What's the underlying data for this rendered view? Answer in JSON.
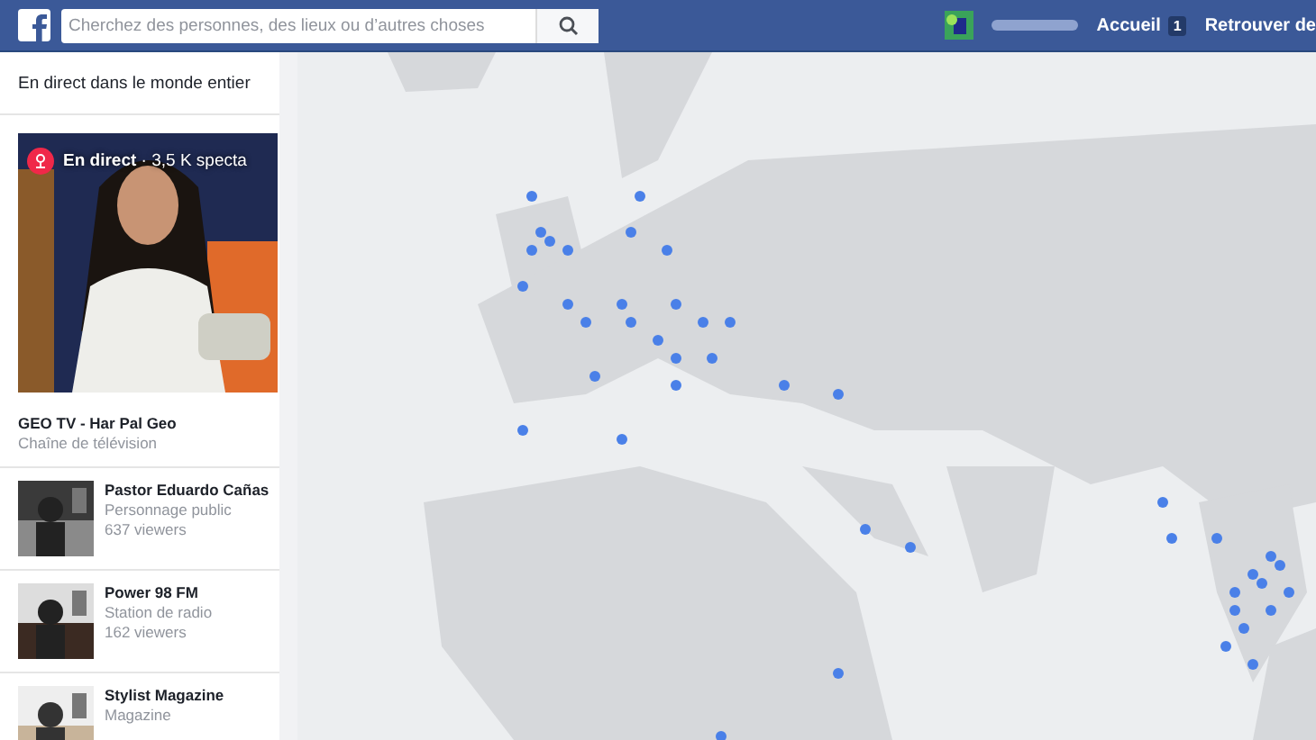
{
  "topbar": {
    "search": {
      "placeholder": "Cherchez des personnes, des lieux ou d’autres choses"
    },
    "nav": [
      {
        "label": "Accueil",
        "badge": "1"
      },
      {
        "label": "Retrouver de"
      }
    ]
  },
  "sidebar": {
    "title": "En direct dans le monde entier",
    "featured": {
      "live_label": "En direct",
      "viewers": " · 3,5 K specta",
      "name": "GEO TV - Har Pal Geo",
      "category": "Chaîne de télévision"
    },
    "items": [
      {
        "name": "Pastor Eduardo Cañas",
        "category": "Personnage public",
        "viewers": "637 viewers"
      },
      {
        "name": "Power 98 FM",
        "category": "Station de radio",
        "viewers": "162 viewers"
      },
      {
        "name": "Stylist Magazine",
        "category": "Magazine"
      }
    ]
  }
}
